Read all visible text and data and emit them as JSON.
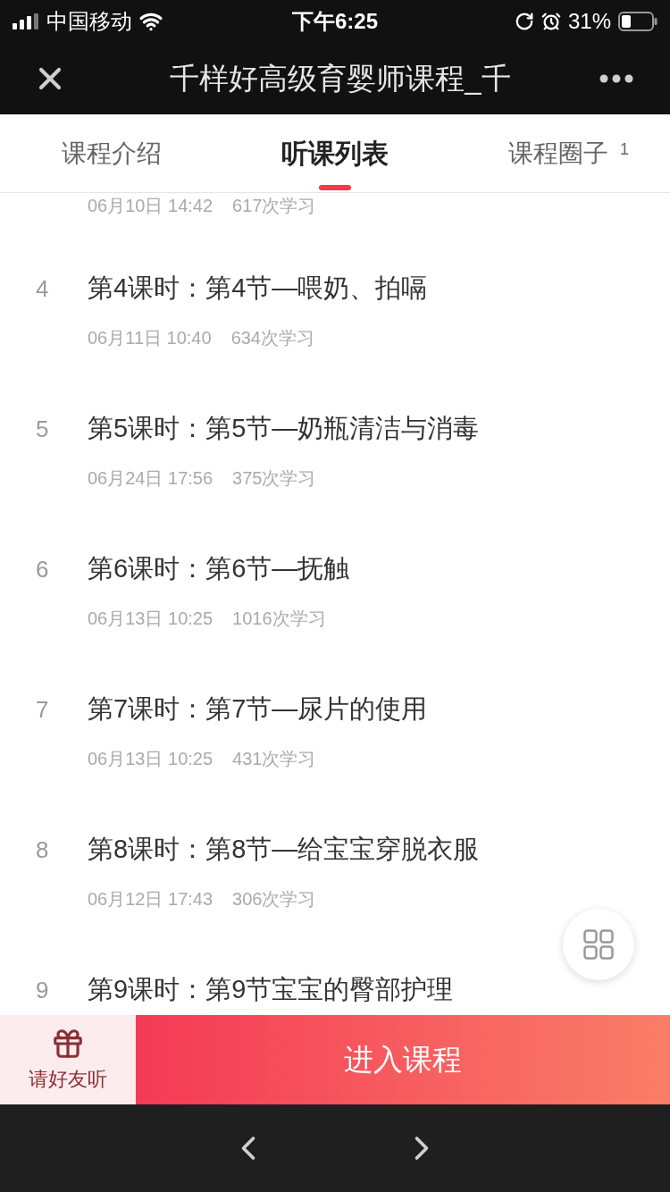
{
  "status_bar": {
    "carrier": "中国移动",
    "time": "下午6:25",
    "battery": "31%"
  },
  "nav": {
    "title": "千样好高级育婴师课程_千"
  },
  "tabs": [
    {
      "label": "课程介绍",
      "selected": false
    },
    {
      "label": "听课列表",
      "selected": true
    },
    {
      "label": "课程圈子",
      "badge": "1",
      "selected": false
    }
  ],
  "lessons": [
    {
      "meta": "06月10日 14:42",
      "views": "617次学习"
    },
    {
      "number": "4",
      "title": "第4课时：第4节—喂奶、拍嗝",
      "meta": "06月11日 10:40",
      "views": "634次学习"
    },
    {
      "number": "5",
      "title": "第5课时：第5节—奶瓶清洁与消毒",
      "meta": "06月24日 17:56",
      "views": "375次学习"
    },
    {
      "number": "6",
      "title": "第6课时：第6节—抚触",
      "meta": "06月13日 10:25",
      "views": "1016次学习"
    },
    {
      "number": "7",
      "title": "第7课时：第7节—尿片的使用",
      "meta": "06月13日 10:25",
      "views": "431次学习"
    },
    {
      "number": "8",
      "title": "第8课时：第8节—给宝宝穿脱衣服",
      "meta": "06月12日 17:43",
      "views": "306次学习"
    },
    {
      "number": "9",
      "title": "第9课时：第9节宝宝的臀部护理"
    }
  ],
  "bottom_bar": {
    "invite": "请好友听",
    "enter": "进入课程"
  }
}
